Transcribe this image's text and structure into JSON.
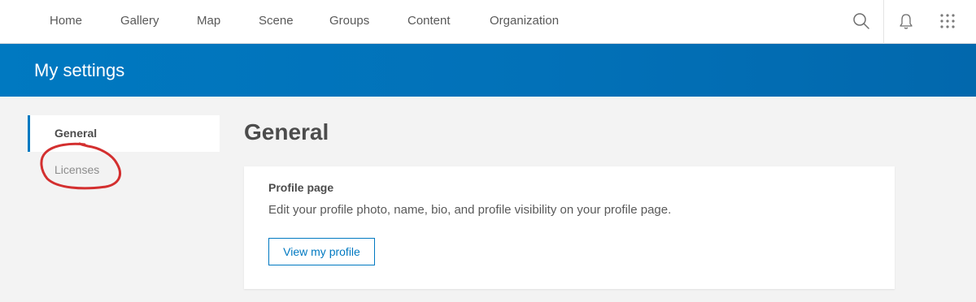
{
  "nav": {
    "items": [
      {
        "label": "Home"
      },
      {
        "label": "Gallery"
      },
      {
        "label": "Map"
      },
      {
        "label": "Scene"
      },
      {
        "label": "Groups"
      },
      {
        "label": "Content"
      },
      {
        "label": "Organization"
      }
    ],
    "icons": [
      "search-icon",
      "bell-icon",
      "app-launcher-icon"
    ]
  },
  "banner": {
    "title": "My settings"
  },
  "sidenav": {
    "items": [
      {
        "label": "General",
        "active": true
      },
      {
        "label": "Licenses",
        "active": false
      }
    ]
  },
  "main": {
    "title": "General",
    "card": {
      "title": "Profile page",
      "description": "Edit your profile photo, name, bio, and profile visibility on your profile page.",
      "button_label": "View my profile"
    }
  },
  "colors": {
    "brand_blue": "#0079c1",
    "annotation_red": "#d32f2f",
    "page_bg": "#f3f3f3"
  }
}
